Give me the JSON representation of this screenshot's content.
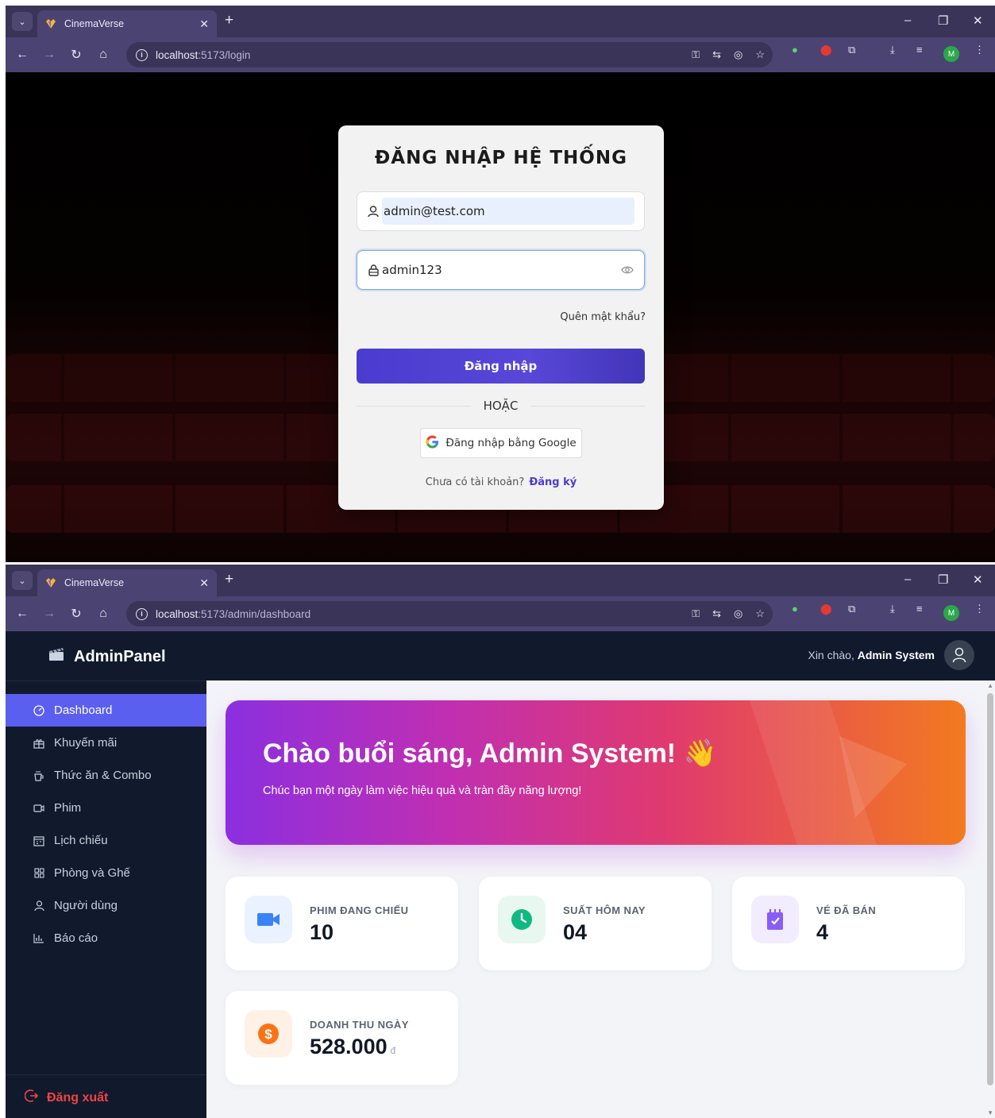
{
  "login_window": {
    "tab_title": "CinemaVerse",
    "url_host": "localhost",
    "url_path": ":5173/login",
    "avatar_initial": "M",
    "card": {
      "title": "ĐĂNG NHẬP HỆ THỐNG",
      "email_value": "admin@test.com",
      "password_value": "admin123",
      "forgot_link": "Quên mật khẩu?",
      "login_button": "Đăng nhập",
      "or_text": "HOẶC",
      "google_button": "Đăng nhập bằng Google",
      "no_account_text": "Chưa có tài khoản?",
      "register_link": "Đăng ký"
    }
  },
  "admin_window": {
    "tab_title": "CinemaVerse",
    "url_host": "localhost",
    "url_path": ":5173/admin/dashboard",
    "avatar_initial": "M",
    "brand": "AdminPanel",
    "menu": [
      {
        "label": "Dashboard",
        "icon": "dashboard-gauge-icon",
        "active": true
      },
      {
        "label": "Khuyến mãi",
        "icon": "gift-icon"
      },
      {
        "label": "Thức ăn & Combo",
        "icon": "cup-icon"
      },
      {
        "label": "Phim",
        "icon": "video-icon"
      },
      {
        "label": "Lịch chiếu",
        "icon": "calendar-icon"
      },
      {
        "label": "Phòng và Ghế",
        "icon": "grid-icon"
      },
      {
        "label": "Người dùng",
        "icon": "user-icon"
      },
      {
        "label": "Báo cáo",
        "icon": "bar-chart-icon"
      }
    ],
    "logout": "Đăng xuất",
    "greeting_prefix": "Xin chào,",
    "greeting_name": "Admin System",
    "hero": {
      "title": "Chào buổi sáng, Admin System!",
      "subtitle": "Chúc bạn một ngày làm việc hiệu quả và tràn đầy năng lượng!"
    },
    "stats": [
      {
        "label": "PHIM ĐANG CHIẾU",
        "value": "10",
        "icon": "video-camera-icon",
        "color": "#3b82f6",
        "bg": "#eaf2ff"
      },
      {
        "label": "SUẤT HÔM NAY",
        "value": "04",
        "icon": "clock-icon",
        "color": "#10b981",
        "bg": "#e8f8f1"
      },
      {
        "label": "VÉ ĐÃ BÁN",
        "value": "4",
        "icon": "ticket-icon",
        "color": "#8b5cf6",
        "bg": "#f1ecff"
      },
      {
        "label": "DOANH THU NGÀY",
        "value": "528.000",
        "unit": "đ",
        "icon": "dollar-icon",
        "color": "#f97316",
        "bg": "#fff1e6"
      }
    ]
  }
}
